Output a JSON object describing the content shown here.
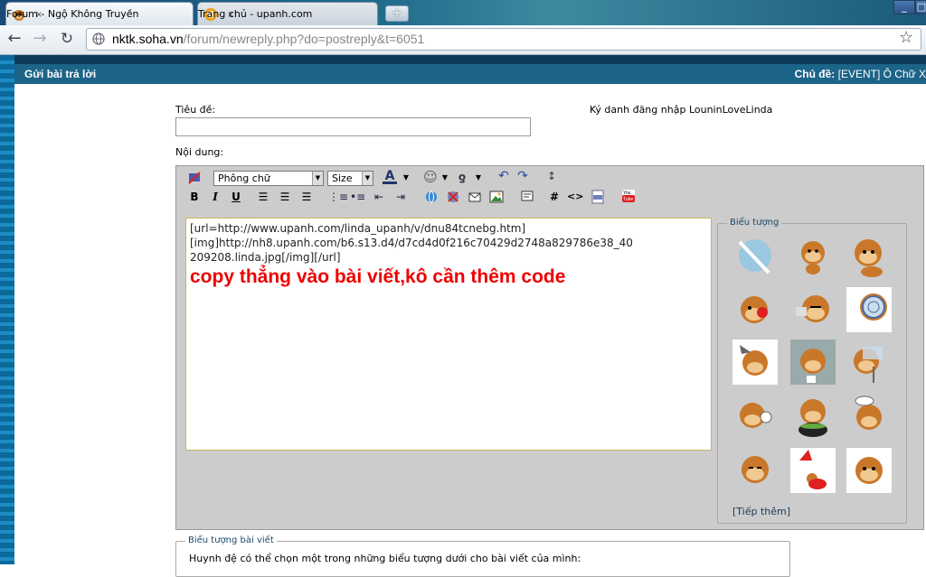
{
  "browser": {
    "tabs": [
      {
        "label": "Forum - Ngộ Không Truyền",
        "close": "×"
      },
      {
        "label": "Trang chủ - upanh.com",
        "close": "×"
      }
    ],
    "new_tab": "+",
    "window_buttons": [
      "_",
      "□",
      "×"
    ],
    "url_host": "nktk.soha.vn",
    "url_path": "/forum/newreply.php?do=postreply&t=6051"
  },
  "page": {
    "header_left": "Gửi bài trả lời",
    "header_right_label": "Chủ đề:",
    "header_right_value": "[EVENT] Ô Chữ X",
    "title_label": "Tiêu đề:",
    "login_text": "Ký danh đăng nhập",
    "login_user": "LouninLoveLinda",
    "content_label": "Nội dung:",
    "font_select": "Phông chữ",
    "size_select": "Size",
    "toolbar_icons": [
      "remove-format-icon",
      "font-color-icon",
      "smiley-icon",
      "quote-icon",
      "undo-icon",
      "redo-icon",
      "resize-icon",
      "bold-icon",
      "italic-icon",
      "underline-icon",
      "align-left-icon",
      "align-center-icon",
      "align-right-icon",
      "ordered-list-icon",
      "unordered-list-icon",
      "outdent-icon",
      "indent-icon",
      "link-icon",
      "unlink-icon",
      "email-icon",
      "image-icon",
      "quote-block-icon",
      "hash-icon",
      "code-icon",
      "php-icon",
      "youtube-icon"
    ],
    "toolbar_letters": {
      "bold": "B",
      "italic": "I",
      "underline": "U",
      "hash": "#",
      "code": "<>"
    },
    "editor_lines": [
      "[url=http://www.upanh.com/linda_upanh/v/dnu84tcnebg.htm]",
      "[img]http://nh8.upanh.com/b6.s13.d4/d7cd4d0f216c70429d2748a829786e38_40",
      "209208.linda.jpg[/img][/url]"
    ],
    "editor_overlay": "copy thẳng vào bài viết,kô cần thêm code",
    "smilies_legend": "Biểu tượng",
    "smilies_more": "[Tiếp thêm]",
    "post_icons_legend": "Biểu tượng bài viết",
    "post_icons_text": "Huynh đệ có thể chọn một trong những biểu tượng dưới cho bài viết của mình:"
  },
  "colors": {
    "header_bg": "#1c6488",
    "page_bg": "#0b3a5a",
    "overlay_red": "#ee0000",
    "editor_bg": "#cccccc"
  }
}
